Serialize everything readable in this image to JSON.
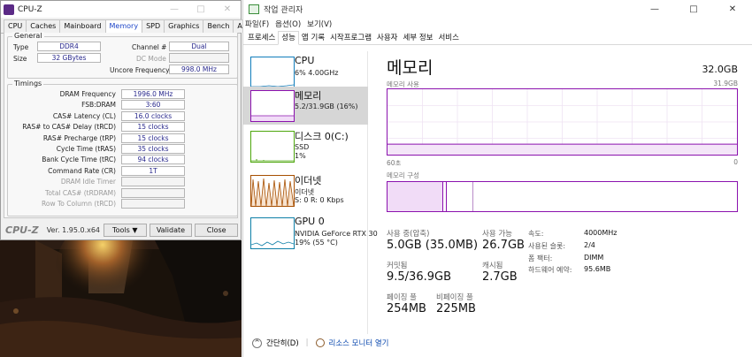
{
  "cpuz": {
    "title": "CPU-Z",
    "tabs": [
      "CPU",
      "Caches",
      "Mainboard",
      "Memory",
      "SPD",
      "Graphics",
      "Bench",
      "About"
    ],
    "active_tab": "Memory",
    "general": {
      "label": "General",
      "type_label": "Type",
      "type_value": "DDR4",
      "size_label": "Size",
      "size_value": "32 GBytes",
      "channel_label": "Channel #",
      "channel_value": "Dual",
      "dc_mode_label": "DC Mode",
      "dc_mode_value": "",
      "uncore_label": "Uncore Frequency",
      "uncore_value": "998.0 MHz"
    },
    "timings": {
      "label": "Timings",
      "rows": [
        {
          "label": "DRAM Frequency",
          "value": "1996.0 MHz"
        },
        {
          "label": "FSB:DRAM",
          "value": "3:60"
        },
        {
          "label": "CAS# Latency (CL)",
          "value": "16.0 clocks"
        },
        {
          "label": "RAS# to CAS# Delay (tRCD)",
          "value": "15 clocks"
        },
        {
          "label": "RAS# Precharge (tRP)",
          "value": "15 clocks"
        },
        {
          "label": "Cycle Time (tRAS)",
          "value": "35 clocks"
        },
        {
          "label": "Bank Cycle Time (tRC)",
          "value": "94 clocks"
        },
        {
          "label": "Command Rate (CR)",
          "value": "1T"
        },
        {
          "label": "DRAM Idle Timer",
          "value": ""
        },
        {
          "label": "Total CAS# (tRDRAM)",
          "value": ""
        },
        {
          "label": "Row To Column (tRCD)",
          "value": ""
        }
      ]
    },
    "footer": {
      "logo": "CPU-Z",
      "version": "Ver. 1.95.0.x64",
      "tools_label": "Tools",
      "validate_label": "Validate",
      "close_label": "Close"
    }
  },
  "taskmgr": {
    "title": "작업 관리자",
    "menu": [
      "파일(F)",
      "옵션(O)",
      "보기(V)"
    ],
    "tabs": [
      "프로세스",
      "성능",
      "앱 기록",
      "시작프로그램",
      "사용자",
      "세부 정보",
      "서비스"
    ],
    "active_tab": "성능",
    "sidebar": [
      {
        "name": "CPU",
        "sub": "6% 4.00GHz",
        "sub2": "",
        "color": "#117dbb"
      },
      {
        "name": "메모리",
        "sub": "5.2/31.9GB (16%)",
        "sub2": "",
        "color": "#8b12ae"
      },
      {
        "name": "디스크 0(C:)",
        "sub": "SSD",
        "sub2": "1%",
        "color": "#4da60c"
      },
      {
        "name": "이더넷",
        "sub": "이더넷",
        "sub2": "S: 0  R: 0 Kbps",
        "color": "#a74f01"
      },
      {
        "name": "GPU 0",
        "sub": "NVIDIA GeForce RTX 30",
        "sub2": "19% (55 °C)",
        "color": "#0e7fa7"
      }
    ],
    "memory": {
      "title": "메모리",
      "total": "32.0GB",
      "usage_label": "메모리 사용",
      "usage_max": "31.9GB",
      "time_left": "60초",
      "time_right": "0",
      "usage_fraction": 0.16,
      "composition_label": "메모리 구성",
      "stats": {
        "in_use_label": "사용 중(압축)",
        "in_use_value": "5.0GB (35.0MB)",
        "available_label": "사용 가능",
        "available_value": "26.7GB",
        "committed_label": "커밋됨",
        "committed_value": "9.5/36.9GB",
        "cached_label": "캐시됨",
        "cached_value": "2.7GB",
        "paged_label": "페이징 풀",
        "paged_value": "254MB",
        "nonpaged_label": "비페이징 풀",
        "nonpaged_value": "225MB"
      },
      "details": [
        {
          "label": "속도:",
          "value": "4000MHz"
        },
        {
          "label": "사용된 슬롯:",
          "value": "2/4"
        },
        {
          "label": "폼 팩터:",
          "value": "DIMM"
        },
        {
          "label": "하드웨어 예약:",
          "value": "95.6MB"
        }
      ]
    },
    "bottom": {
      "fewer_details": "간단히(D)",
      "resource_monitor": "리소스 모니터 열기"
    }
  }
}
